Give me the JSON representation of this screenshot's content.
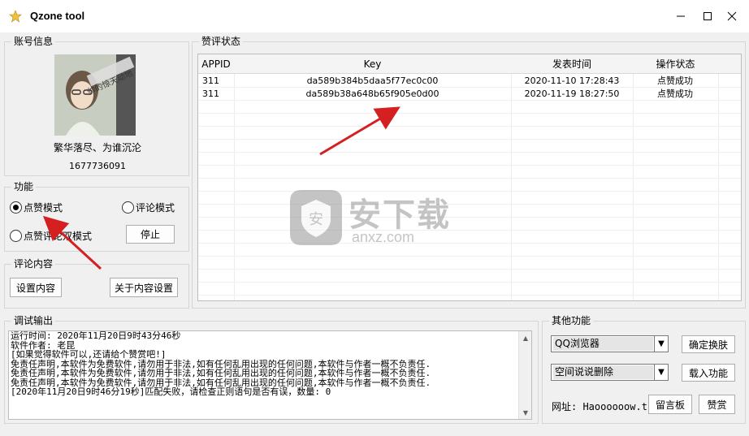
{
  "window": {
    "title": "Qzone tool"
  },
  "account": {
    "legend": "账号信息",
    "avatar_text": "帅的惊天动地",
    "nickname": "繁华落尽、为谁沉沦",
    "qq": "1677736091"
  },
  "function": {
    "legend": "功能",
    "like_mode": "点赞模式",
    "comment_mode": "评论模式",
    "like_comment_mode": "点赞评论双模式",
    "stop_button": "停止"
  },
  "comment_content": {
    "legend": "评论内容",
    "set_content_button": "设置内容",
    "about_button": "关于内容设置"
  },
  "status": {
    "legend": "赞评状态",
    "columns": [
      "APPID",
      "Key",
      "发表时间",
      "操作状态"
    ],
    "rows": [
      {
        "appid": "311",
        "key": "da589b384b5daa5f77ec0c00",
        "time": "2020-11-10 17:28:43",
        "state": "点赞成功"
      },
      {
        "appid": "311",
        "key": "da589b38a648b65f905e0d00",
        "time": "2020-11-19 18:27:50",
        "state": "点赞成功"
      }
    ]
  },
  "debug": {
    "legend": "调试输出",
    "lines": [
      "运行时间: 2020年11月20日9时43分46秒",
      "软件作者: 老昆",
      "[如果觉得软件可以,还请给个赞赏吧!]",
      "免责任声明,本软件为免费软件,请勿用于非法,如有任何乱用出现的任何问题,本软件与作者一概不负责任.",
      "免责任声明,本软件为免费软件,请勿用于非法,如有任何乱用出现的任何问题,本软件与作者一概不负责任.",
      "免责任声明,本软件为免费软件,请勿用于非法,如有任何乱用出现的任何问题,本软件与作者一概不负责任.",
      "[2020年11月20日9时46分19秒]匹配失败，请检查正则语句是否有误，数量: 0"
    ]
  },
  "other": {
    "legend": "其他功能",
    "browser_select": "QQ浏览器",
    "confirm_button": "确定换肤",
    "action_select": "空间说说删除",
    "load_button": "载入功能",
    "url_label": "网址: Haoooooow.tk",
    "guestbook_button": "留言板",
    "reward_button": "赞赏"
  },
  "watermark": {
    "text": "安下载",
    "subtext": "anxz.com"
  },
  "colors": {
    "accent_arrow": "#d42020",
    "checked_radio": "#000000"
  }
}
